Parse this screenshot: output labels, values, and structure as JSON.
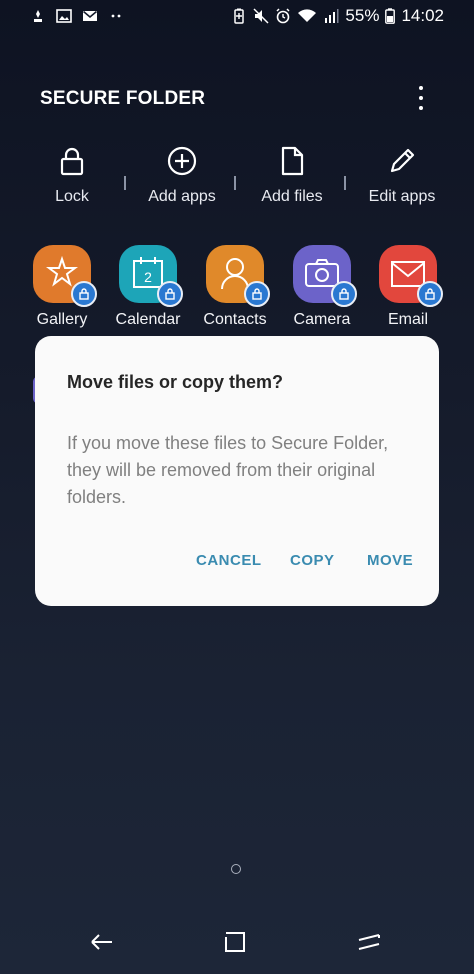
{
  "status_bar": {
    "battery": "55%",
    "time": "14:02",
    "icons": [
      "bixby-icon",
      "image-icon",
      "gmail-icon",
      "more-dots-icon",
      "battery-saver-icon",
      "mute-icon",
      "alarm-icon",
      "wifi-icon",
      "signal-icon",
      "battery-icon"
    ]
  },
  "header": {
    "title": "SECURE FOLDER"
  },
  "actions": [
    {
      "label": "Lock",
      "icon": "lock-icon"
    },
    {
      "label": "Add apps",
      "icon": "add-circle-icon"
    },
    {
      "label": "Add files",
      "icon": "file-icon"
    },
    {
      "label": "Edit apps",
      "icon": "pencil-icon"
    }
  ],
  "apps": [
    {
      "label": "Gallery",
      "color": "#e07a2c"
    },
    {
      "label": "Calendar",
      "color": "#1da5b8"
    },
    {
      "label": "Contacts",
      "color": "#e0892a"
    },
    {
      "label": "Camera",
      "color": "#6c63c9"
    },
    {
      "label": "Email",
      "color": "#e2473d"
    }
  ],
  "dialog": {
    "title": "Move files or copy them?",
    "body": "If you move these files to Secure Folder, they will be removed from their original folders.",
    "cancel": "CANCEL",
    "copy": "COPY",
    "move": "MOVE"
  },
  "nav": {
    "icons": [
      "back-icon",
      "recents-icon",
      "home-icon"
    ]
  }
}
